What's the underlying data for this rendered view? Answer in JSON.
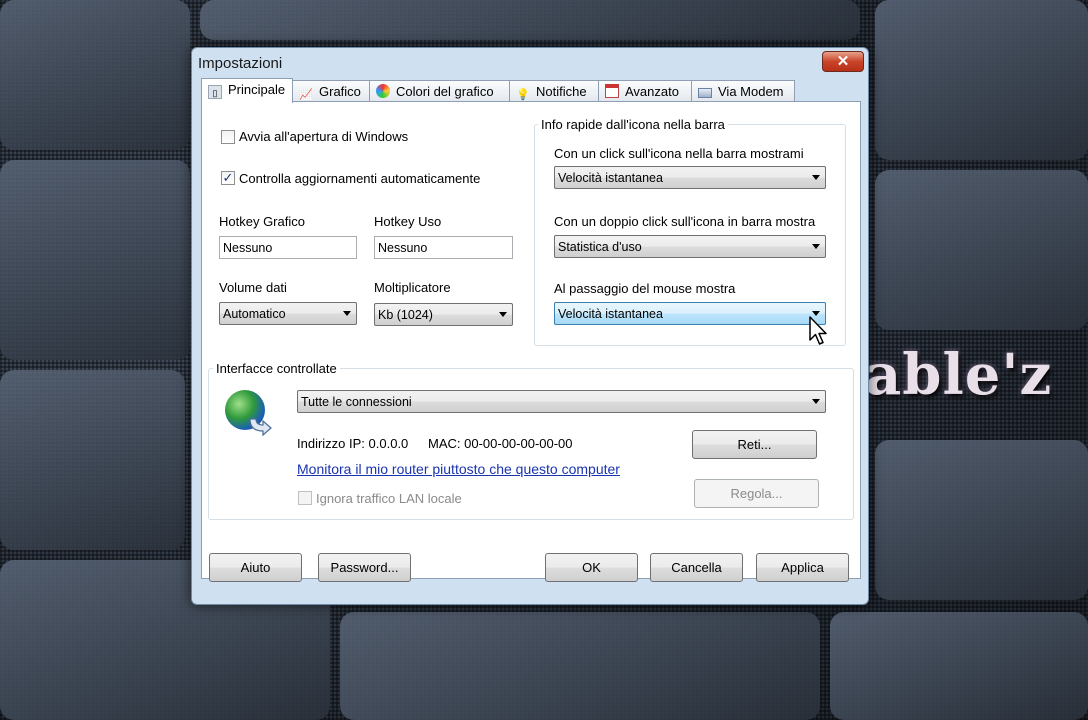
{
  "window": {
    "title": "Impostazioni",
    "close_glyph": "✕"
  },
  "background_text": "able'z",
  "tabs": [
    {
      "label": "Principale",
      "icon": "principale-icon"
    },
    {
      "label": "Grafico",
      "icon": "chart-icon"
    },
    {
      "label": "Colori del grafico",
      "icon": "palette-icon"
    },
    {
      "label": "Notifiche",
      "icon": "lightbulb-icon"
    },
    {
      "label": "Avanzato",
      "icon": "calendar-icon"
    },
    {
      "label": "Via Modem",
      "icon": "modem-icon"
    }
  ],
  "general": {
    "startup_label": "Avvia all'apertura di Windows",
    "startup_checked": false,
    "updates_label": "Controlla aggiornamenti automaticamente",
    "updates_checked": true,
    "updates_mark": "✓",
    "hotkey_graph_label": "Hotkey Grafico",
    "hotkey_graph_value": "Nessuno",
    "hotkey_usage_label": "Hotkey Uso",
    "hotkey_usage_value": "Nessuno",
    "data_volume_label": "Volume dati",
    "data_volume_value": "Automatico",
    "multiplier_label": "Moltiplicatore",
    "multiplier_value": "Kb (1024)"
  },
  "tray_info": {
    "group_title": "Info rapide dall'icona nella barra",
    "click_label": "Con un click sull'icona nella barra mostrami",
    "click_value": "Velocità istantanea",
    "dblclick_label": "Con un doppio click sull'icona in barra mostra",
    "dblclick_value": "Statistica d'uso",
    "hover_label": "Al passaggio del mouse mostra",
    "hover_value": "Velocità istantanea"
  },
  "interfaces": {
    "group_title": "Interfacce controllate",
    "connection_value": "Tutte le connessioni",
    "ip_text": "Indirizzo IP: 0.0.0.0",
    "mac_text": "MAC: 00-00-00-00-00-00",
    "networks_button": "Reti...",
    "router_link": "Monitora il mio router piuttosto che questo computer",
    "ignore_lan_label": "Ignora traffico LAN locale",
    "adjust_button": "Regola..."
  },
  "footer": {
    "help": "Aiuto",
    "password": "Password...",
    "ok": "OK",
    "cancel": "Cancella",
    "apply": "Applica"
  }
}
